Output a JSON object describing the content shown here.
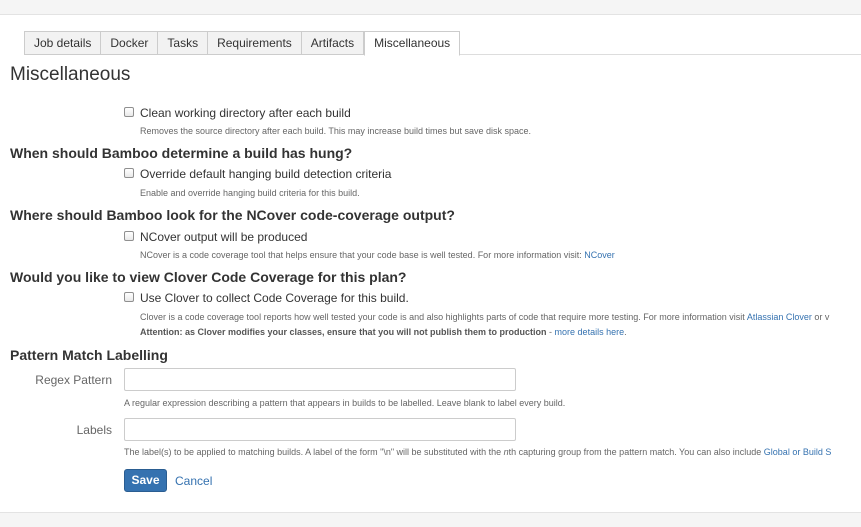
{
  "tabs": [
    {
      "label": "Job details"
    },
    {
      "label": "Docker"
    },
    {
      "label": "Tasks"
    },
    {
      "label": "Requirements"
    },
    {
      "label": "Artifacts"
    },
    {
      "label": "Miscellaneous",
      "active": true
    }
  ],
  "page_title": "Miscellaneous",
  "clean": {
    "label": "Clean working directory after each build",
    "desc": "Removes the source directory after each build. This may increase build times but save disk space."
  },
  "hung": {
    "heading": "When should Bamboo determine a build has hung?",
    "label": "Override default hanging build detection criteria",
    "desc": "Enable and override hanging build criteria for this build."
  },
  "ncover": {
    "heading": "Where should Bamboo look for the NCover code-coverage output?",
    "label": "NCover output will be produced",
    "desc": "NCover is a code coverage tool that helps ensure that your code base is well tested. For more information visit: ",
    "link": "NCover"
  },
  "clover": {
    "heading": "Would you like to view Clover Code Coverage for this plan?",
    "label": "Use Clover to collect Code Coverage for this build.",
    "desc": "Clover is a code coverage tool reports how well tested your code is and also highlights parts of code that require more testing. For more information visit ",
    "link": "Atlassian Clover",
    "desc_tail": " or v",
    "attention": "Attention: as Clover modifies your classes, ensure that you will not publish them to production",
    "attention_sep": " - ",
    "attention_link": "more details here",
    "attention_end": "."
  },
  "pattern": {
    "heading": "Pattern Match Labelling",
    "regex_label": "Regex Pattern",
    "regex_value": "",
    "regex_desc": "A regular expression describing a pattern that appears in builds to be labelled. Leave blank to label every build.",
    "labels_label": "Labels",
    "labels_value": "",
    "labels_desc_1": "The label(s) to be applied to matching builds. A label of the form \"\\n\" will be substituted with the ",
    "labels_desc_em": "n",
    "labels_desc_2": "th capturing group from the pattern match. You can also include ",
    "labels_link": "Global or Build S"
  },
  "actions": {
    "save": "Save",
    "cancel": "Cancel"
  },
  "colors": {
    "link": "#3572b0",
    "primary_button": "#3572b0"
  }
}
